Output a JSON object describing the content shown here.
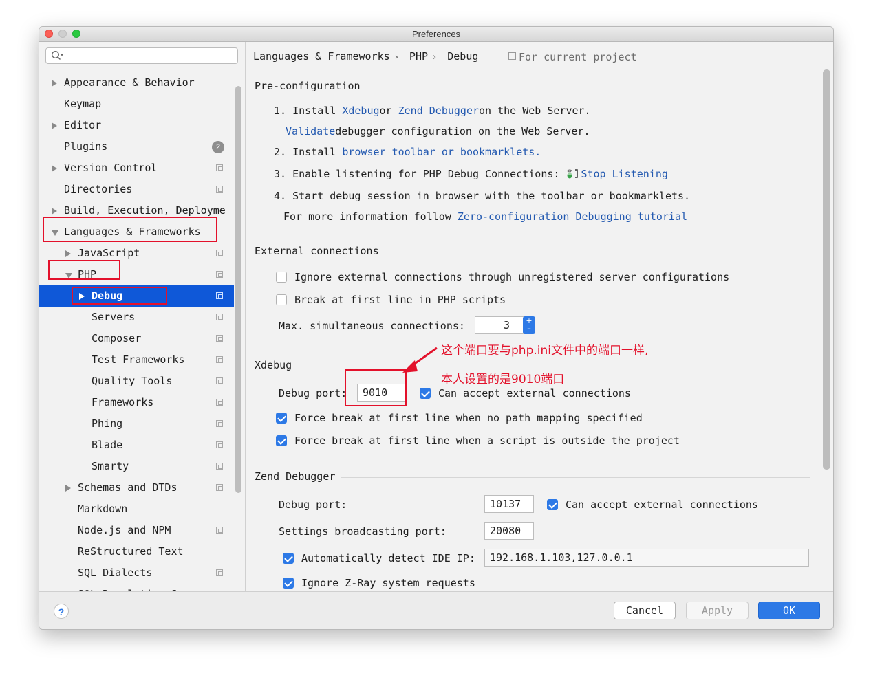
{
  "window": {
    "title": "Preferences"
  },
  "search": {
    "placeholder": ""
  },
  "sidebar": {
    "items": [
      {
        "label": "Appearance & Behavior",
        "arrow": "right"
      },
      {
        "label": "Keymap"
      },
      {
        "label": "Editor",
        "arrow": "right"
      },
      {
        "label": "Plugins",
        "badge": "2"
      },
      {
        "label": "Version Control",
        "arrow": "right"
      },
      {
        "label": "Directories"
      },
      {
        "label": "Build, Execution, Deployme",
        "arrow": "right"
      },
      {
        "label": "Languages & Frameworks",
        "arrow": "down"
      },
      {
        "label": "JavaScript",
        "arrow": "right"
      },
      {
        "label": "PHP",
        "arrow": "down"
      },
      {
        "label": "Debug",
        "arrow": "right",
        "selected": true
      },
      {
        "label": "Servers"
      },
      {
        "label": "Composer"
      },
      {
        "label": "Test Frameworks"
      },
      {
        "label": "Quality Tools"
      },
      {
        "label": "Frameworks"
      },
      {
        "label": "Phing"
      },
      {
        "label": "Blade"
      },
      {
        "label": "Smarty"
      },
      {
        "label": "Schemas and DTDs",
        "arrow": "right"
      },
      {
        "label": "Markdown"
      },
      {
        "label": "Node.js and NPM"
      },
      {
        "label": "ReStructured Text"
      },
      {
        "label": "SQL Dialects"
      },
      {
        "label": "SQL Resolution S"
      }
    ]
  },
  "breadcrumb": {
    "part1": "Languages & Frameworks",
    "part2": "PHP",
    "part3": "Debug",
    "sep": "›"
  },
  "scope": {
    "label": "For current project",
    "icon": "project-scope-icon"
  },
  "preconfig": {
    "title": "Pre-configuration",
    "step1_a": "1. Install",
    "step1_xdebug": "Xdebug",
    "step1_or": "or",
    "step1_zend": "Zend Debugger",
    "step1_b": "on the Web Server.",
    "validate_link": "Validate",
    "validate_rest": "debugger configuration on the Web Server.",
    "step2_a": "2. Install",
    "step2_link": "browser toolbar or bookmarklets.",
    "step3_a": "3. Enable listening for PHP Debug Connections:",
    "step3_link": "Stop Listening",
    "step4": "4. Start debug session in browser with the toolbar or bookmarklets.",
    "more_a": "For more information follow",
    "more_link": "Zero-configuration Debugging tutorial"
  },
  "external": {
    "title": "External connections",
    "ignore_label": "Ignore external connections through unregistered server configurations",
    "break_label": "Break at first line in PHP scripts",
    "max_label": "Max. simultaneous connections:",
    "max_value": "3",
    "spinner_up": "+",
    "spinner_down": "–"
  },
  "xdebug": {
    "title": "Xdebug",
    "port_label": "Debug port:",
    "port_value": "9010",
    "accept_label": "Can accept external connections",
    "force1_label": "Force break at first line when no path mapping specified",
    "force2_label": "Force break at first line when a script is outside the project"
  },
  "zend": {
    "title": "Zend Debugger",
    "port_label": "Debug port:",
    "port_value": "10137",
    "accept_label": "Can accept external connections",
    "broadcast_label": "Settings broadcasting port:",
    "broadcast_value": "20080",
    "detect_label": "Automatically detect IDE IP:",
    "detect_value": "192.168.1.103,127.0.0.1",
    "zray_label": "Ignore Z-Ray system requests"
  },
  "footer": {
    "help": "?",
    "cancel": "Cancel",
    "apply": "Apply",
    "ok": "OK"
  },
  "annotation": {
    "line1": "这个端口要与php.ini文件中的端口一样,",
    "line2": "本人设置的是9010端口",
    "color": "#e3112b"
  },
  "colors": {
    "accent": "#2d79e6",
    "selection": "#0f58d8",
    "link": "#2359b0"
  }
}
